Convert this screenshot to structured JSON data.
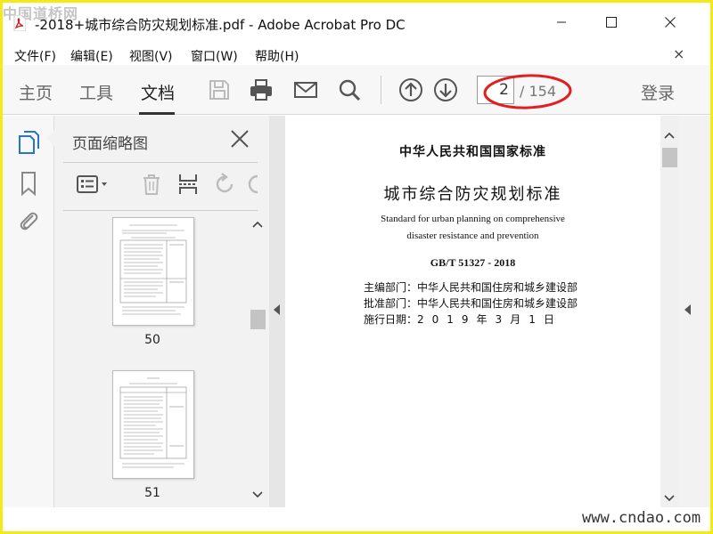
{
  "titlebar": {
    "title": "-2018+城市综合防灾规划标准.pdf - Adobe Acrobat Pro DC",
    "watermark": "中国道桥网"
  },
  "menubar": {
    "items": [
      "文件(F)",
      "编辑(E)",
      "视图(V)",
      "窗口(W)",
      "帮助(H)"
    ],
    "close_glyph": "×"
  },
  "toolbar": {
    "tabs": [
      "主页",
      "工具",
      "文档"
    ],
    "active_tab": "文档",
    "page_current": "2",
    "page_total": "/ 154",
    "login": "登录"
  },
  "thumbnails": {
    "title": "页面缩略图",
    "pages": [
      {
        "label": "50"
      },
      {
        "label": "51"
      }
    ]
  },
  "document": {
    "national": "中华人民共和国国家标准",
    "title": "城市综合防灾规划标准",
    "en_line1": "Standard for urban planning on comprehensive",
    "en_line2": "disaster resistance and prevention",
    "code": "GB/T 51327 - 2018",
    "meta": [
      {
        "label": "主编部门：",
        "value": "中华人民共和国住房和城乡建设部"
      },
      {
        "label": "批准部门：",
        "value": "中华人民共和国住房和城乡建设部"
      },
      {
        "label": "施行日期：",
        "value": "2019年3月1日"
      }
    ]
  },
  "footer": {
    "watermark_url": "www.cndao.com"
  },
  "colors": {
    "accent": "#2b73c7",
    "pdf_red": "#d7191c",
    "annotation_red": "#e02020"
  }
}
